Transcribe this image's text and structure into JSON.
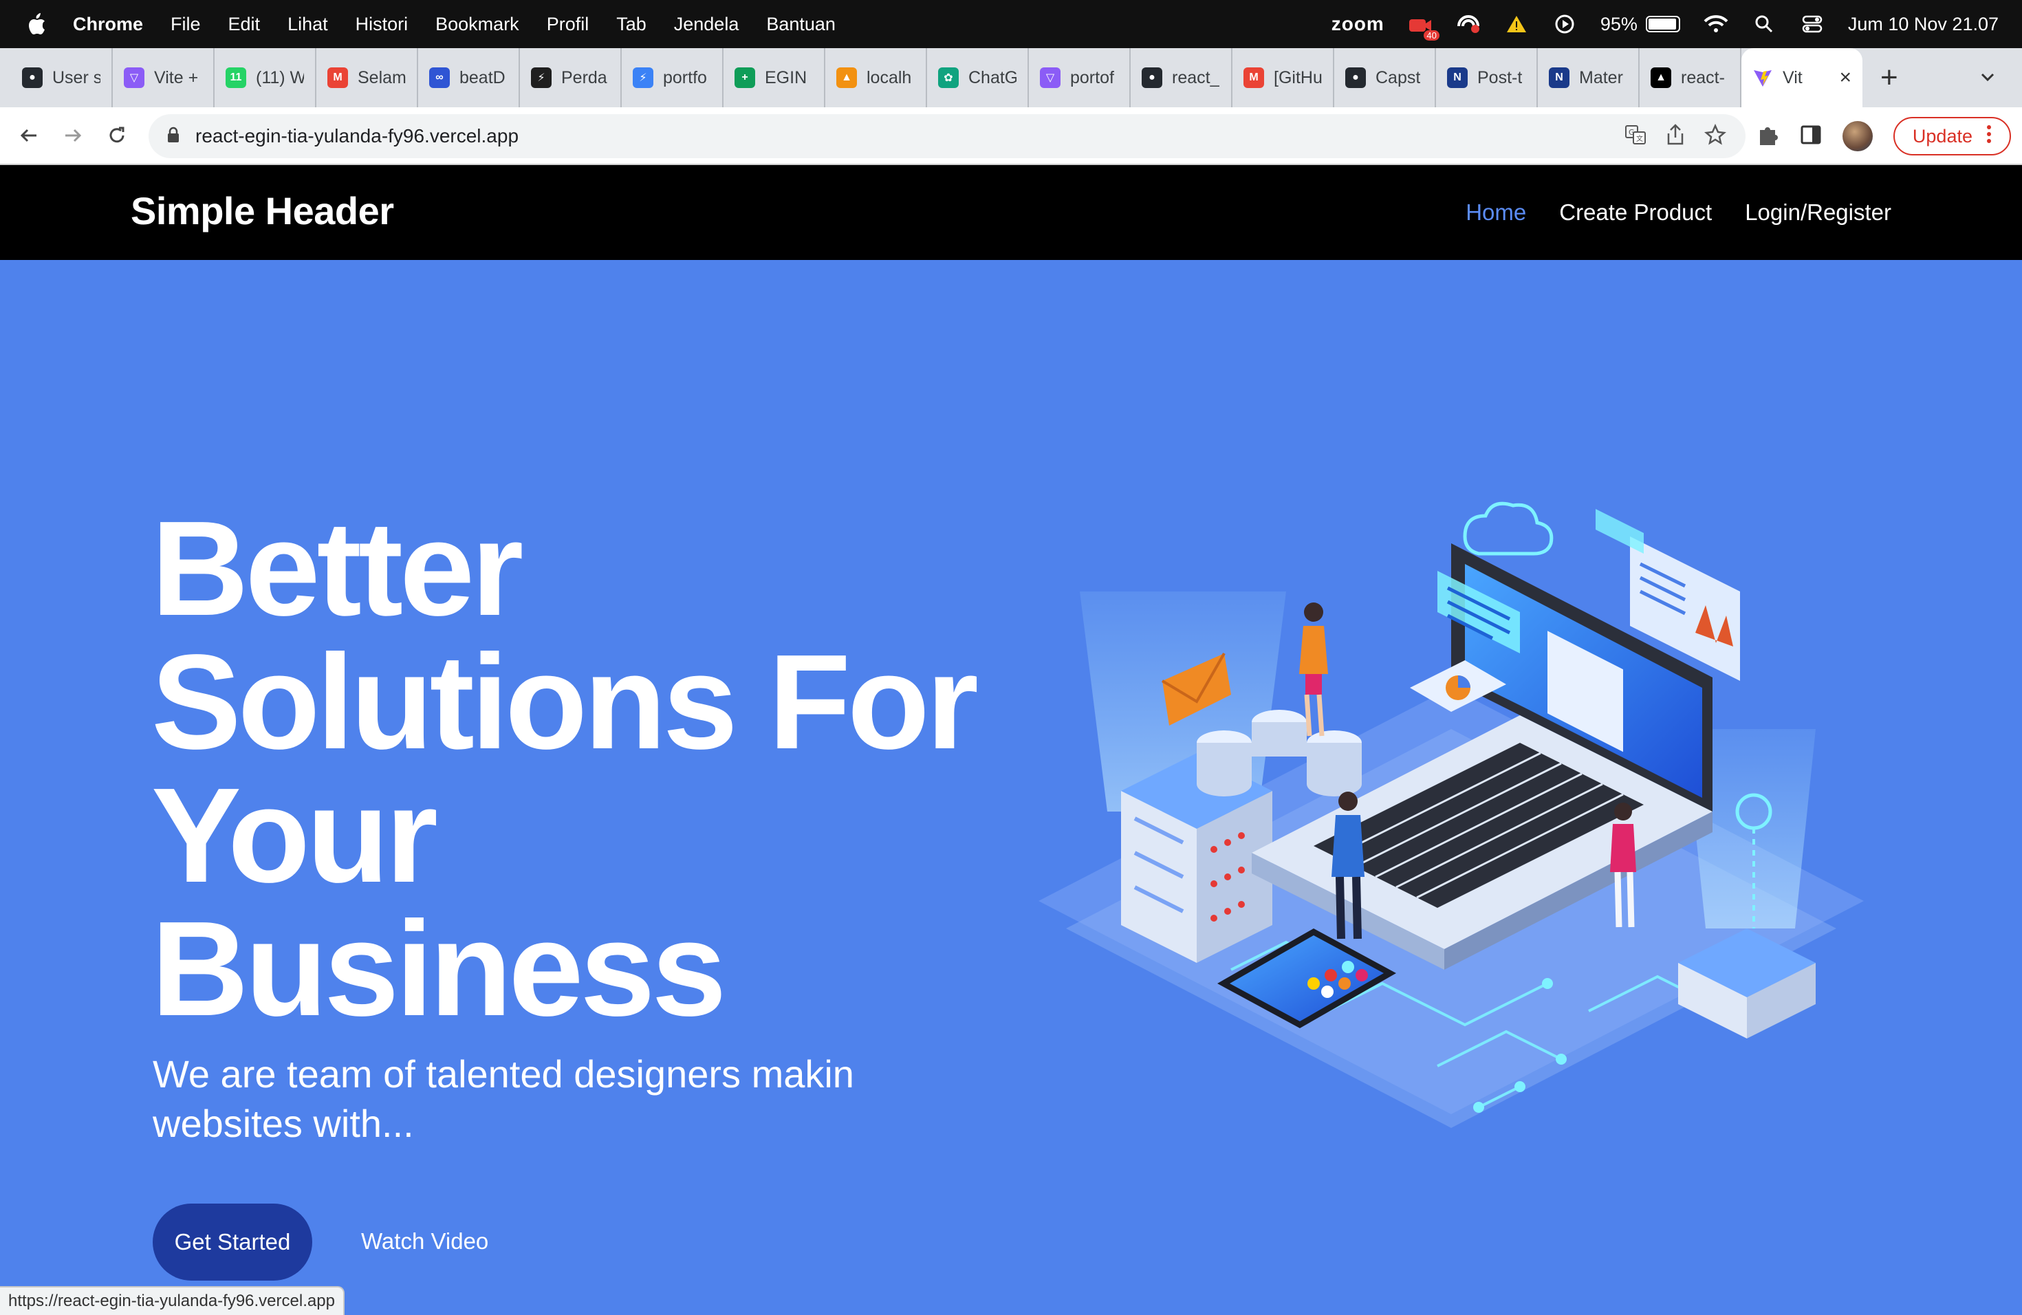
{
  "menubar": {
    "app": "Chrome",
    "items": [
      "File",
      "Edit",
      "Lihat",
      "Histori",
      "Bookmark",
      "Profil",
      "Tab",
      "Jendela",
      "Bantuan"
    ],
    "zoom": "zoom",
    "badge": "40",
    "battery": "95%",
    "battery_level": 0.95,
    "datetime": "Jum 10 Nov  21.07"
  },
  "tabs": [
    {
      "label": "User s",
      "icon": "github-icon",
      "color": "#24292f"
    },
    {
      "label": "Vite +",
      "icon": "vite-icon",
      "color": "#8b5cf6"
    },
    {
      "label": "(11) W",
      "icon": "whatsapp-icon",
      "color": "#25d366"
    },
    {
      "label": "Selam",
      "icon": "gmail-icon",
      "color": "#ea4335"
    },
    {
      "label": "beatD",
      "icon": "beatd-icon",
      "color": "#2f55d4"
    },
    {
      "label": "Perda",
      "icon": "bolt-icon",
      "color": "#1f1f1f"
    },
    {
      "label": "portfo",
      "icon": "bolt-icon",
      "color": "#3b82f6"
    },
    {
      "label": "EGIN",
      "icon": "sheets-icon",
      "color": "#0f9d58"
    },
    {
      "label": "localh",
      "icon": "phpmyadmin-icon",
      "color": "#f29111"
    },
    {
      "label": "ChatG",
      "icon": "chatgpt-icon",
      "color": "#10a37f"
    },
    {
      "label": "portof",
      "icon": "vite-icon",
      "color": "#8b5cf6"
    },
    {
      "label": "react_",
      "icon": "github-icon",
      "color": "#24292f"
    },
    {
      "label": "[GitHu",
      "icon": "gmail-icon",
      "color": "#ea4335"
    },
    {
      "label": "Capst",
      "icon": "github-icon",
      "color": "#24292f"
    },
    {
      "label": "Post-t",
      "icon": "onenote-icon",
      "color": "#1a3a8a"
    },
    {
      "label": "Mater",
      "icon": "onenote-icon",
      "color": "#1a3a8a"
    },
    {
      "label": "react-",
      "icon": "vercel-icon",
      "color": "#000000"
    }
  ],
  "active_tab": {
    "label": "Vit",
    "icon": "vite-icon"
  },
  "address": {
    "url": "react-egin-tia-yulanda-fy96.vercel.app"
  },
  "toolbar": {
    "update_label": "Update"
  },
  "site": {
    "brand": "Simple Header",
    "nav": [
      "Home",
      "Create Product",
      "Login/Register"
    ],
    "active_nav": "Home"
  },
  "hero": {
    "title_lines": [
      "Better",
      "Solutions For",
      "Your",
      "Business"
    ],
    "subtitle_lines": [
      "We are team of talented designers makin",
      "websites with..."
    ],
    "primary_cta": "Get Started",
    "secondary_cta": "Watch Video",
    "illustration": "isometric-tech-illustration"
  },
  "status_bar": {
    "url": "https://react-egin-tia-yulanda-fy96.vercel.app"
  },
  "colors": {
    "hero_bg": "#4f82ec",
    "header_bg": "#000000",
    "nav_active": "#5b8cf5",
    "cta_bg": "#1e3a9e"
  }
}
